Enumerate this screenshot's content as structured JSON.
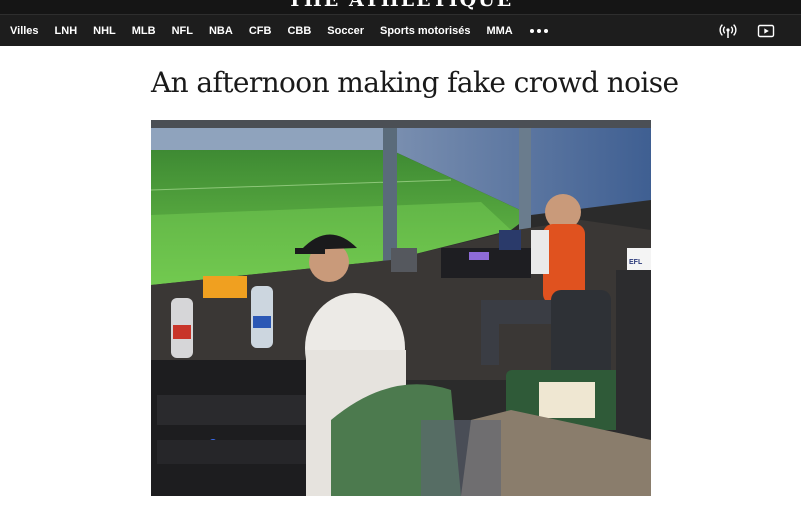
{
  "site": {
    "masthead": "THE ATHLETIQUE"
  },
  "nav": {
    "items": [
      "Villes",
      "LNH",
      "NHL",
      "MLB",
      "NFL",
      "NBA",
      "CFB",
      "CBB",
      "Soccer",
      "Sports motorisés",
      "MMA"
    ],
    "more_icon": "more-dots-icon",
    "right_icons": [
      "podcast-icon",
      "video-play-icon"
    ]
  },
  "article": {
    "headline": "An afternoon making fake crowd noise",
    "photo": {
      "sign_text": "EFL"
    }
  },
  "colors": {
    "topbar": "#151515",
    "nav": "#1d1d1d",
    "pitch": "#4a9a3c",
    "vest": "#e0521f",
    "text": "#1a1a1a"
  }
}
